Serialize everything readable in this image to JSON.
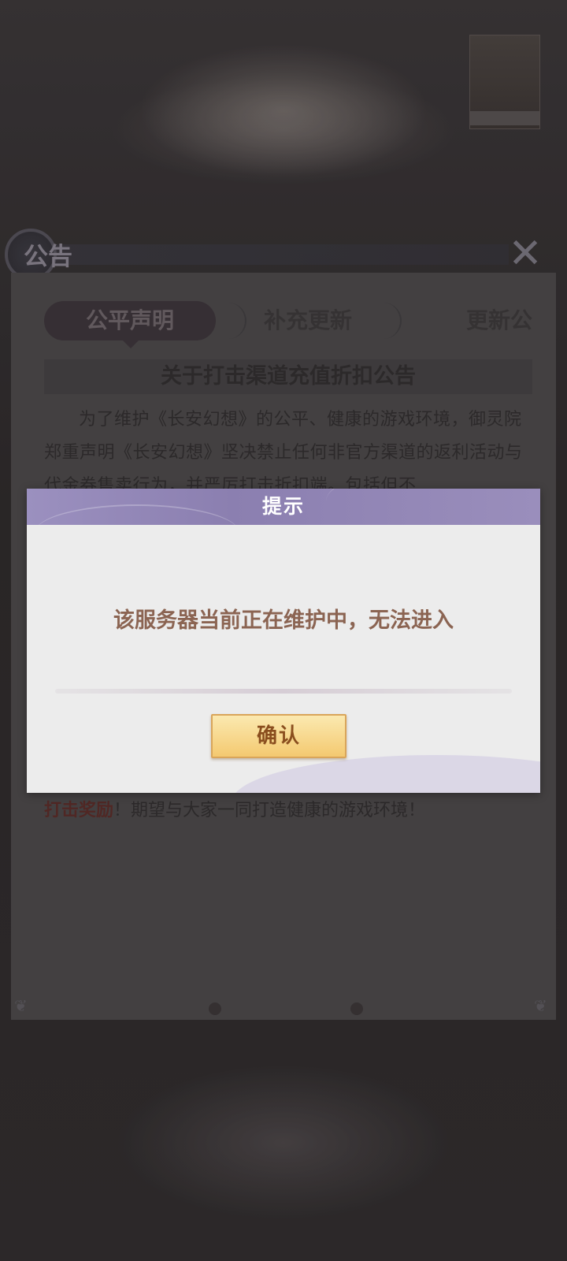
{
  "announcement": {
    "header_title": "公告",
    "tabs": [
      {
        "label": "公平声明",
        "active": true
      },
      {
        "label": "补充更新",
        "active": false
      },
      {
        "label": "更新公",
        "active": false
      }
    ],
    "article_title": "关于打击渠道充值折扣公告",
    "article_body": "为了维护《长安幻想》的公平、健康的游戏环境，御灵院郑重声明《长安幻想》坚决禁止任何非官方渠道的返利活动与代金券售卖行为，并严厉打击折扣端。包括但不",
    "footer_emphasis": "打击奖励",
    "footer_text": "！期望与大家一同打造健康的游戏环境！"
  },
  "dialog": {
    "title": "提示",
    "message": "该服务器当前正在维护中，无法进入",
    "confirm_label": "确认"
  },
  "colors": {
    "dialog_header": "#9b90bf",
    "message_text": "#8b6452",
    "confirm_button": "#f4c970",
    "confirm_text": "#8a4e1e"
  },
  "icons": {
    "close": "close-icon"
  }
}
